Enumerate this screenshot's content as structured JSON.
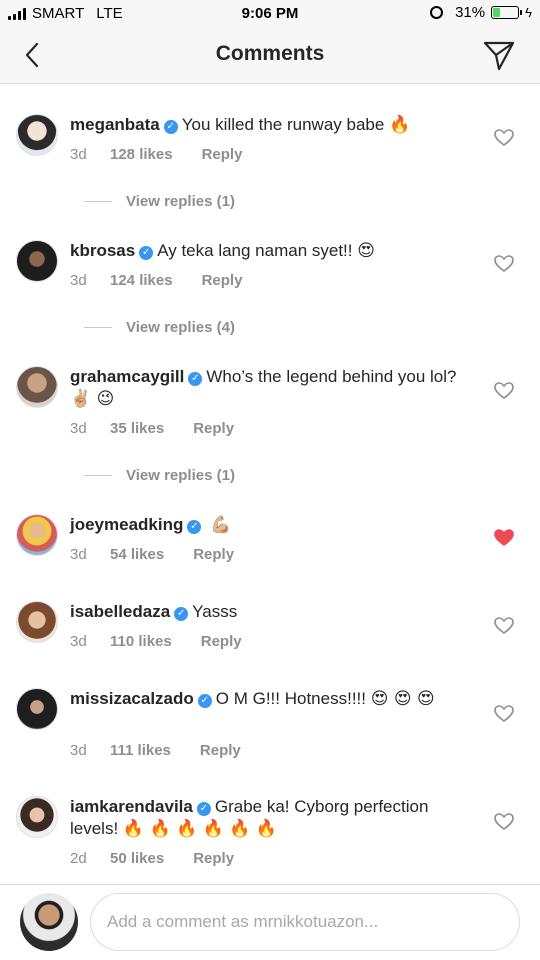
{
  "status_bar": {
    "carrier": "SMART",
    "network": "LTE",
    "time": "9:06 PM",
    "battery_level": "31%",
    "battery_fraction": 0.31,
    "battery_color": "#4cd964"
  },
  "header": {
    "title": "Comments",
    "back_icon": "chevron-left-icon",
    "send_icon": "paper-plane-icon"
  },
  "comments": [
    {
      "username": "meganbata",
      "text": "You killed the runway babe",
      "emoji": "🔥",
      "time": "3d",
      "likes": "128 likes",
      "reply": "Reply",
      "liked": false,
      "view_replies": "View replies (1)"
    },
    {
      "username": "kbrosas",
      "text": "Ay teka lang naman syet!!",
      "emoji": "😍",
      "time": "3d",
      "likes": "124 likes",
      "reply": "Reply",
      "liked": false,
      "view_replies": "View replies (4)"
    },
    {
      "username": "grahamcaygill",
      "text": "Who’s the legend behind you lol?",
      "emoji": "✌🏼 😉",
      "time": "3d",
      "likes": "35 likes",
      "reply": "Reply",
      "liked": false,
      "view_replies": "View replies (1)"
    },
    {
      "username": "joeymeadking",
      "text": "",
      "emoji": "💪🏼",
      "time": "3d",
      "likes": "54 likes",
      "reply": "Reply",
      "liked": true,
      "view_replies": ""
    },
    {
      "username": "isabelledaza",
      "text": "Yasss",
      "emoji": "",
      "time": "3d",
      "likes": "110 likes",
      "reply": "Reply",
      "liked": false,
      "view_replies": ""
    },
    {
      "username": "missizacalzado",
      "text": "O M G!!! Hotness!!!!",
      "emoji": "😍 😍 😍",
      "time": "3d",
      "likes": "111 likes",
      "reply": "Reply",
      "liked": false,
      "view_replies": ""
    },
    {
      "username": "iamkarendavila",
      "text": "Grabe ka! Cyborg perfection levels!",
      "emoji": "🔥 🔥 🔥 🔥 🔥 🔥",
      "time": "2d",
      "likes": "50 likes",
      "reply": "Reply",
      "liked": false,
      "view_replies": ""
    }
  ],
  "composer": {
    "placeholder": "Add a comment as mrnikkotuazon..."
  },
  "colors": {
    "verified": "#3897f0",
    "liked_heart": "#ed4956",
    "muted_text": "#8e8e8e"
  }
}
